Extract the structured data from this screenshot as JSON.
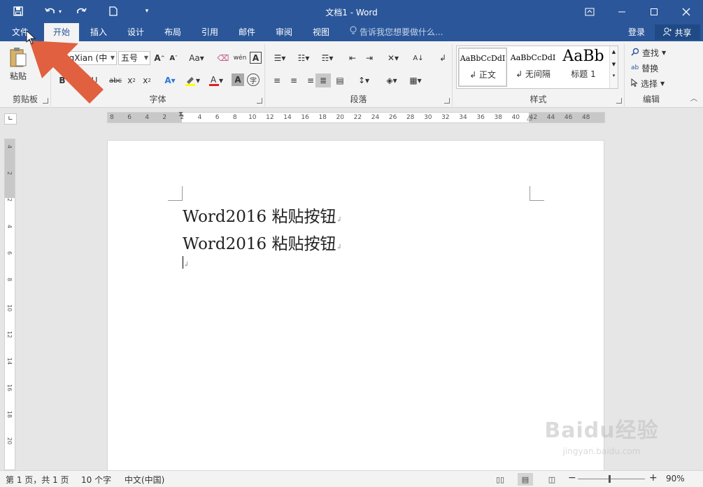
{
  "titlebar": {
    "title": "文档1 - Word",
    "qat": {
      "save_icon": "save-icon",
      "undo_icon": "undo-icon",
      "redo_icon": "redo-icon",
      "new_icon": "new-doc-icon"
    },
    "window_controls": [
      "ribbon-display-icon",
      "minimize-icon",
      "maximize-icon",
      "close-icon"
    ]
  },
  "tabs": {
    "file": "文件",
    "items": [
      "开始",
      "插入",
      "设计",
      "布局",
      "引用",
      "邮件",
      "审阅",
      "视图"
    ],
    "active": "开始",
    "tell_me": "告诉我您想要做什么...",
    "login": "登录",
    "share": "共享"
  },
  "ribbon": {
    "clipboard": {
      "label": "剪贴板",
      "paste": "粘贴"
    },
    "font": {
      "label": "字体",
      "font_name": "ngXian (中",
      "font_size": "五号"
    },
    "paragraph": {
      "label": "段落"
    },
    "styles": {
      "label": "样式",
      "items": [
        {
          "sample": "AaBbCcDdI",
          "name": "↲ 正文"
        },
        {
          "sample": "AaBbCcDdI",
          "name": "↲ 无间隔"
        },
        {
          "sample": "AaBb",
          "name": "标题 1"
        }
      ]
    },
    "editing": {
      "label": "编辑",
      "find": "查找",
      "replace": "替换",
      "select": "选择"
    }
  },
  "ruler": {
    "h_ticks": [
      "8",
      "6",
      "4",
      "2",
      "2",
      "4",
      "6",
      "8",
      "10",
      "12",
      "14",
      "16",
      "18",
      "20",
      "22",
      "24",
      "26",
      "28",
      "30",
      "32",
      "34",
      "36",
      "38",
      "40",
      "42",
      "44",
      "46",
      "48"
    ],
    "v_ticks": [
      "4",
      "2",
      "2",
      "4",
      "6",
      "8",
      "10",
      "12",
      "14",
      "16",
      "18",
      "20"
    ]
  },
  "document": {
    "lines": [
      "Word2016 粘贴按钮",
      "Word2016 粘贴按钮",
      ""
    ]
  },
  "statusbar": {
    "page": "第 1 页，共 1 页",
    "words": "10 个字",
    "language": "中文(中国)",
    "zoom": "90%",
    "zoom_level": 0.9
  },
  "accent_color": "#2b579a",
  "arrow_color": "#e06040",
  "watermark": {
    "brand": "Baidu经验",
    "url": "jingyan.baidu.com"
  }
}
